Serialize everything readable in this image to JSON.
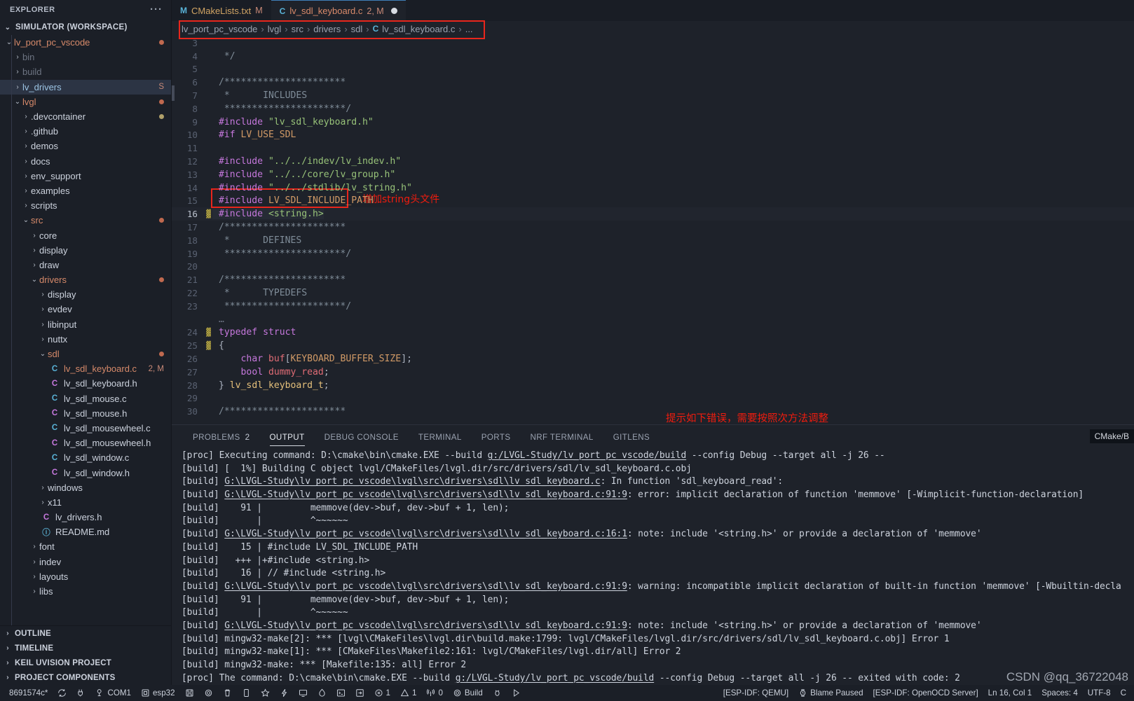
{
  "sidebar": {
    "title": "EXPLORER",
    "more_label": "···",
    "workspace": "SIMULATOR (WORKSPACE)",
    "tree": [
      {
        "label": "lv_port_pc_vscode",
        "indent": 0,
        "kind": "folder-open",
        "color": "orange",
        "dot": "#c0694f",
        "badge": ""
      },
      {
        "label": "bin",
        "indent": 1,
        "kind": "folder",
        "color": "dim",
        "dot": "",
        "badge": ""
      },
      {
        "label": "build",
        "indent": 1,
        "kind": "folder",
        "color": "dim",
        "dot": "",
        "badge": ""
      },
      {
        "label": "lv_drivers",
        "indent": 1,
        "kind": "folder",
        "color": "blue",
        "dot": "",
        "badge": "S",
        "selected": true
      },
      {
        "label": "lvgl",
        "indent": 1,
        "kind": "folder-open",
        "color": "orange",
        "dot": "#c0694f",
        "badge": ""
      },
      {
        "label": ".devcontainer",
        "indent": 2,
        "kind": "folder",
        "color": "normal",
        "dot": "#b0a06a",
        "badge": ""
      },
      {
        "label": ".github",
        "indent": 2,
        "kind": "folder",
        "color": "normal",
        "dot": "",
        "badge": ""
      },
      {
        "label": "demos",
        "indent": 2,
        "kind": "folder",
        "color": "normal",
        "dot": "",
        "badge": ""
      },
      {
        "label": "docs",
        "indent": 2,
        "kind": "folder",
        "color": "normal",
        "dot": "",
        "badge": ""
      },
      {
        "label": "env_support",
        "indent": 2,
        "kind": "folder",
        "color": "normal",
        "dot": "",
        "badge": ""
      },
      {
        "label": "examples",
        "indent": 2,
        "kind": "folder",
        "color": "normal",
        "dot": "",
        "badge": ""
      },
      {
        "label": "scripts",
        "indent": 2,
        "kind": "folder",
        "color": "normal",
        "dot": "",
        "badge": ""
      },
      {
        "label": "src",
        "indent": 2,
        "kind": "folder-open",
        "color": "orange",
        "dot": "#c0694f",
        "badge": ""
      },
      {
        "label": "core",
        "indent": 3,
        "kind": "folder",
        "color": "normal",
        "dot": "",
        "badge": ""
      },
      {
        "label": "display",
        "indent": 3,
        "kind": "folder",
        "color": "normal",
        "dot": "",
        "badge": ""
      },
      {
        "label": "draw",
        "indent": 3,
        "kind": "folder",
        "color": "normal",
        "dot": "",
        "badge": ""
      },
      {
        "label": "drivers",
        "indent": 3,
        "kind": "folder-open",
        "color": "orange",
        "dot": "#c0694f",
        "badge": ""
      },
      {
        "label": "display",
        "indent": 4,
        "kind": "folder",
        "color": "normal",
        "dot": "",
        "badge": ""
      },
      {
        "label": "evdev",
        "indent": 4,
        "kind": "folder",
        "color": "normal",
        "dot": "",
        "badge": ""
      },
      {
        "label": "libinput",
        "indent": 4,
        "kind": "folder",
        "color": "normal",
        "dot": "",
        "badge": ""
      },
      {
        "label": "nuttx",
        "indent": 4,
        "kind": "folder",
        "color": "normal",
        "dot": "",
        "badge": ""
      },
      {
        "label": "sdl",
        "indent": 4,
        "kind": "folder-open",
        "color": "orange",
        "dot": "#c0694f",
        "badge": ""
      },
      {
        "label": "lv_sdl_keyboard.c",
        "indent": 5,
        "kind": "file-c",
        "color": "orange",
        "dot": "",
        "badge": "2, M"
      },
      {
        "label": "lv_sdl_keyboard.h",
        "indent": 5,
        "kind": "file-h",
        "color": "normal",
        "dot": "",
        "badge": ""
      },
      {
        "label": "lv_sdl_mouse.c",
        "indent": 5,
        "kind": "file-c",
        "color": "normal",
        "dot": "",
        "badge": ""
      },
      {
        "label": "lv_sdl_mouse.h",
        "indent": 5,
        "kind": "file-h",
        "color": "normal",
        "dot": "",
        "badge": ""
      },
      {
        "label": "lv_sdl_mousewheel.c",
        "indent": 5,
        "kind": "file-c",
        "color": "normal",
        "dot": "",
        "badge": ""
      },
      {
        "label": "lv_sdl_mousewheel.h",
        "indent": 5,
        "kind": "file-h",
        "color": "normal",
        "dot": "",
        "badge": ""
      },
      {
        "label": "lv_sdl_window.c",
        "indent": 5,
        "kind": "file-c",
        "color": "normal",
        "dot": "",
        "badge": ""
      },
      {
        "label": "lv_sdl_window.h",
        "indent": 5,
        "kind": "file-h",
        "color": "normal",
        "dot": "",
        "badge": ""
      },
      {
        "label": "windows",
        "indent": 4,
        "kind": "folder",
        "color": "normal",
        "dot": "",
        "badge": ""
      },
      {
        "label": "x11",
        "indent": 4,
        "kind": "folder",
        "color": "normal",
        "dot": "",
        "badge": ""
      },
      {
        "label": "lv_drivers.h",
        "indent": 4,
        "kind": "file-h",
        "color": "normal",
        "dot": "",
        "badge": ""
      },
      {
        "label": "README.md",
        "indent": 4,
        "kind": "file-md",
        "color": "normal",
        "dot": "",
        "badge": ""
      },
      {
        "label": "font",
        "indent": 3,
        "kind": "folder",
        "color": "normal",
        "dot": "",
        "badge": ""
      },
      {
        "label": "indev",
        "indent": 3,
        "kind": "folder",
        "color": "normal",
        "dot": "",
        "badge": ""
      },
      {
        "label": "layouts",
        "indent": 3,
        "kind": "folder",
        "color": "normal",
        "dot": "",
        "badge": ""
      },
      {
        "label": "libs",
        "indent": 3,
        "kind": "folder",
        "color": "normal",
        "dot": "",
        "badge": ""
      }
    ],
    "bottom_sections": [
      "OUTLINE",
      "TIMELINE",
      "KEIL UVISION PROJECT",
      "PROJECT COMPONENTS"
    ]
  },
  "tabs": [
    {
      "icon": "M",
      "name": "CMakeLists.txt",
      "badge": "M",
      "active": false,
      "dirty": false
    },
    {
      "icon": "C",
      "name": "lv_sdl_keyboard.c",
      "badge": "2, M",
      "active": true,
      "dirty": true
    }
  ],
  "breadcrumb": {
    "items": [
      "lv_port_pc_vscode",
      "lvgl",
      "src",
      "drivers",
      "sdl"
    ],
    "file_icon": "C",
    "file": "lv_sdl_keyboard.c",
    "trailing": "..."
  },
  "editor": {
    "lines": [
      {
        "n": "3",
        "text": "",
        "partial": true
      },
      {
        "n": "4",
        "text": " */",
        "cls": "k-comment"
      },
      {
        "n": "5",
        "text": ""
      },
      {
        "n": "6",
        "text": "/**********************",
        "cls": "k-comment"
      },
      {
        "n": "7",
        "text": " *      INCLUDES",
        "cls": "k-comment"
      },
      {
        "n": "8",
        "text": " **********************/",
        "cls": "k-comment"
      },
      {
        "n": "9",
        "text": "#include \"lv_sdl_keyboard.h\""
      },
      {
        "n": "10",
        "text": "#if LV_USE_SDL"
      },
      {
        "n": "11",
        "text": ""
      },
      {
        "n": "12",
        "text": "#include \"../../indev/lv_indev.h\""
      },
      {
        "n": "13",
        "text": "#include \"../../core/lv_group.h\""
      },
      {
        "n": "14",
        "text": "#include \"../../stdlib/lv_string.h\""
      },
      {
        "n": "15",
        "text": "#include LV_SDL_INCLUDE_PATH"
      },
      {
        "n": "16",
        "text": "#include <string.h>",
        "highlight": true
      },
      {
        "n": "17",
        "text": "/**********************",
        "cls": "k-comment"
      },
      {
        "n": "18",
        "text": " *      DEFINES",
        "cls": "k-comment"
      },
      {
        "n": "19",
        "text": " **********************/",
        "cls": "k-comment"
      },
      {
        "n": "20",
        "text": ""
      },
      {
        "n": "21",
        "text": "/**********************",
        "cls": "k-comment"
      },
      {
        "n": "22",
        "text": " *      TYPEDEFS",
        "cls": "k-comment"
      },
      {
        "n": "23",
        "text": " **********************/",
        "cls": "k-comment"
      },
      {
        "n": "",
        "text": "...",
        "fold": true
      },
      {
        "n": "24",
        "text": "typedef struct"
      },
      {
        "n": "25",
        "text": "{"
      },
      {
        "n": "26",
        "text": "    char buf[KEYBOARD_BUFFER_SIZE];"
      },
      {
        "n": "27",
        "text": "    bool dummy_read;"
      },
      {
        "n": "28",
        "text": "} lv_sdl_keyboard_t;"
      },
      {
        "n": "29",
        "text": ""
      },
      {
        "n": "30",
        "text": "/**********************",
        "cls": "k-comment"
      }
    ],
    "annotation_cn": "增加string头文件"
  },
  "panel": {
    "tabs": [
      {
        "label": "PROBLEMS",
        "count": "2",
        "active": false
      },
      {
        "label": "OUTPUT",
        "count": "",
        "active": true
      },
      {
        "label": "DEBUG CONSOLE",
        "count": "",
        "active": false
      },
      {
        "label": "TERMINAL",
        "count": "",
        "active": false
      },
      {
        "label": "PORTS",
        "count": "",
        "active": false
      },
      {
        "label": "NRF TERMINAL",
        "count": "",
        "active": false
      },
      {
        "label": "GITLENS",
        "count": "",
        "active": false
      }
    ],
    "annotation_cn": "提示如下错误，需要按照次方法调整",
    "source_chip": "CMake/B",
    "output_lines": [
      "[proc] Executing command: D:\\cmake\\bin\\cmake.EXE --build g:/LVGL-Study/lv_port_pc_vscode/build --config Debug --target all -j 26 --",
      "[build] [  1%] Building C object lvgl/CMakeFiles/lvgl.dir/src/drivers/sdl/lv_sdl_keyboard.c.obj",
      "[build] G:\\LVGL-Study\\lv_port_pc_vscode\\lvgl\\src\\drivers\\sdl\\lv_sdl_keyboard.c: In function 'sdl_keyboard_read':",
      "[build] G:\\LVGL-Study\\lv_port_pc_vscode\\lvgl\\src\\drivers\\sdl\\lv_sdl_keyboard.c:91:9: error: implicit declaration of function 'memmove' [-Wimplicit-function-declaration]",
      "[build]    91 |         memmove(dev->buf, dev->buf + 1, len);",
      "[build]       |         ^~~~~~~",
      "[build] G:\\LVGL-Study\\lv_port_pc_vscode\\lvgl\\src\\drivers\\sdl\\lv_sdl_keyboard.c:16:1: note: include '<string.h>' or provide a declaration of 'memmove'",
      "[build]    15 | #include LV_SDL_INCLUDE_PATH",
      "[build]   +++ |+#include <string.h>",
      "[build]    16 | // #include <string.h>",
      "[build] G:\\LVGL-Study\\lv_port_pc_vscode\\lvgl\\src\\drivers\\sdl\\lv_sdl_keyboard.c:91:9: warning: incompatible implicit declaration of built-in function 'memmove' [-Wbuiltin-decla",
      "[build]    91 |         memmove(dev->buf, dev->buf + 1, len);",
      "[build]       |         ^~~~~~~",
      "[build] G:\\LVGL-Study\\lv_port_pc_vscode\\lvgl\\src\\drivers\\sdl\\lv_sdl_keyboard.c:91:9: note: include '<string.h>' or provide a declaration of 'memmove'",
      "[build] mingw32-make[2]: *** [lvgl\\CMakeFiles\\lvgl.dir\\build.make:1799: lvgl/CMakeFiles/lvgl.dir/src/drivers/sdl/lv_sdl_keyboard.c.obj] Error 1",
      "[build] mingw32-make[1]: *** [CMakeFiles\\Makefile2:161: lvgl/CMakeFiles/lvgl.dir/all] Error 2",
      "[build] mingw32-make: *** [Makefile:135: all] Error 2",
      "[proc] The command: D:\\cmake\\bin\\cmake.EXE --build g:/LVGL-Study/lv_port_pc_vscode/build --config Debug --target all -j 26 -- exited with code: 2"
    ]
  },
  "statusbar": {
    "left": [
      {
        "name": "git-branch-status",
        "icon": "",
        "label": "8691574c*"
      },
      {
        "name": "sync-icon",
        "icon": "sync",
        "label": ""
      },
      {
        "name": "serial-monitor-icon",
        "icon": "plug",
        "label": ""
      },
      {
        "name": "com-port",
        "icon": "usb",
        "label": "COM1"
      },
      {
        "name": "board-target",
        "icon": "chip",
        "label": "esp32"
      },
      {
        "name": "flash-icon",
        "icon": "save",
        "label": ""
      },
      {
        "name": "settings-gear-icon",
        "icon": "gear",
        "label": ""
      },
      {
        "name": "erase-flash-icon",
        "icon": "trash",
        "label": ""
      },
      {
        "name": "device-icon",
        "icon": "device",
        "label": ""
      },
      {
        "name": "favorite-icon",
        "icon": "star",
        "label": ""
      },
      {
        "name": "debug-icon",
        "icon": "bolt",
        "label": ""
      },
      {
        "name": "monitor-icon",
        "icon": "monitor",
        "label": ""
      },
      {
        "name": "flame-icon",
        "icon": "flame",
        "label": ""
      },
      {
        "name": "terminal-icon",
        "icon": "terminal",
        "label": ""
      },
      {
        "name": "open-icon",
        "icon": "openbox",
        "label": ""
      },
      {
        "name": "error-count",
        "icon": "error",
        "label": "1"
      },
      {
        "name": "warning-count",
        "icon": "warning",
        "label": "1"
      },
      {
        "name": "radio-tower-count",
        "icon": "tower",
        "label": "0"
      },
      {
        "name": "build-status",
        "icon": "gear",
        "label": "Build"
      },
      {
        "name": "bug-icon",
        "icon": "bug",
        "label": ""
      },
      {
        "name": "run-icon",
        "icon": "play",
        "label": ""
      }
    ],
    "right": [
      {
        "name": "esp-idf-qemu",
        "icon": "",
        "label": "[ESP-IDF: QEMU]"
      },
      {
        "name": "blame-paused",
        "icon": "watch",
        "label": "Blame Paused"
      },
      {
        "name": "esp-idf-openocd",
        "icon": "",
        "label": "[ESP-IDF: OpenOCD Server]"
      },
      {
        "name": "cursor-position",
        "icon": "",
        "label": "Ln 16, Col 1"
      },
      {
        "name": "indentation",
        "icon": "",
        "label": "Spaces: 4"
      },
      {
        "name": "encoding",
        "icon": "",
        "label": "UTF-8"
      },
      {
        "name": "eol",
        "icon": "",
        "label": "C"
      }
    ]
  },
  "watermark": "CSDN @qq_36722048"
}
